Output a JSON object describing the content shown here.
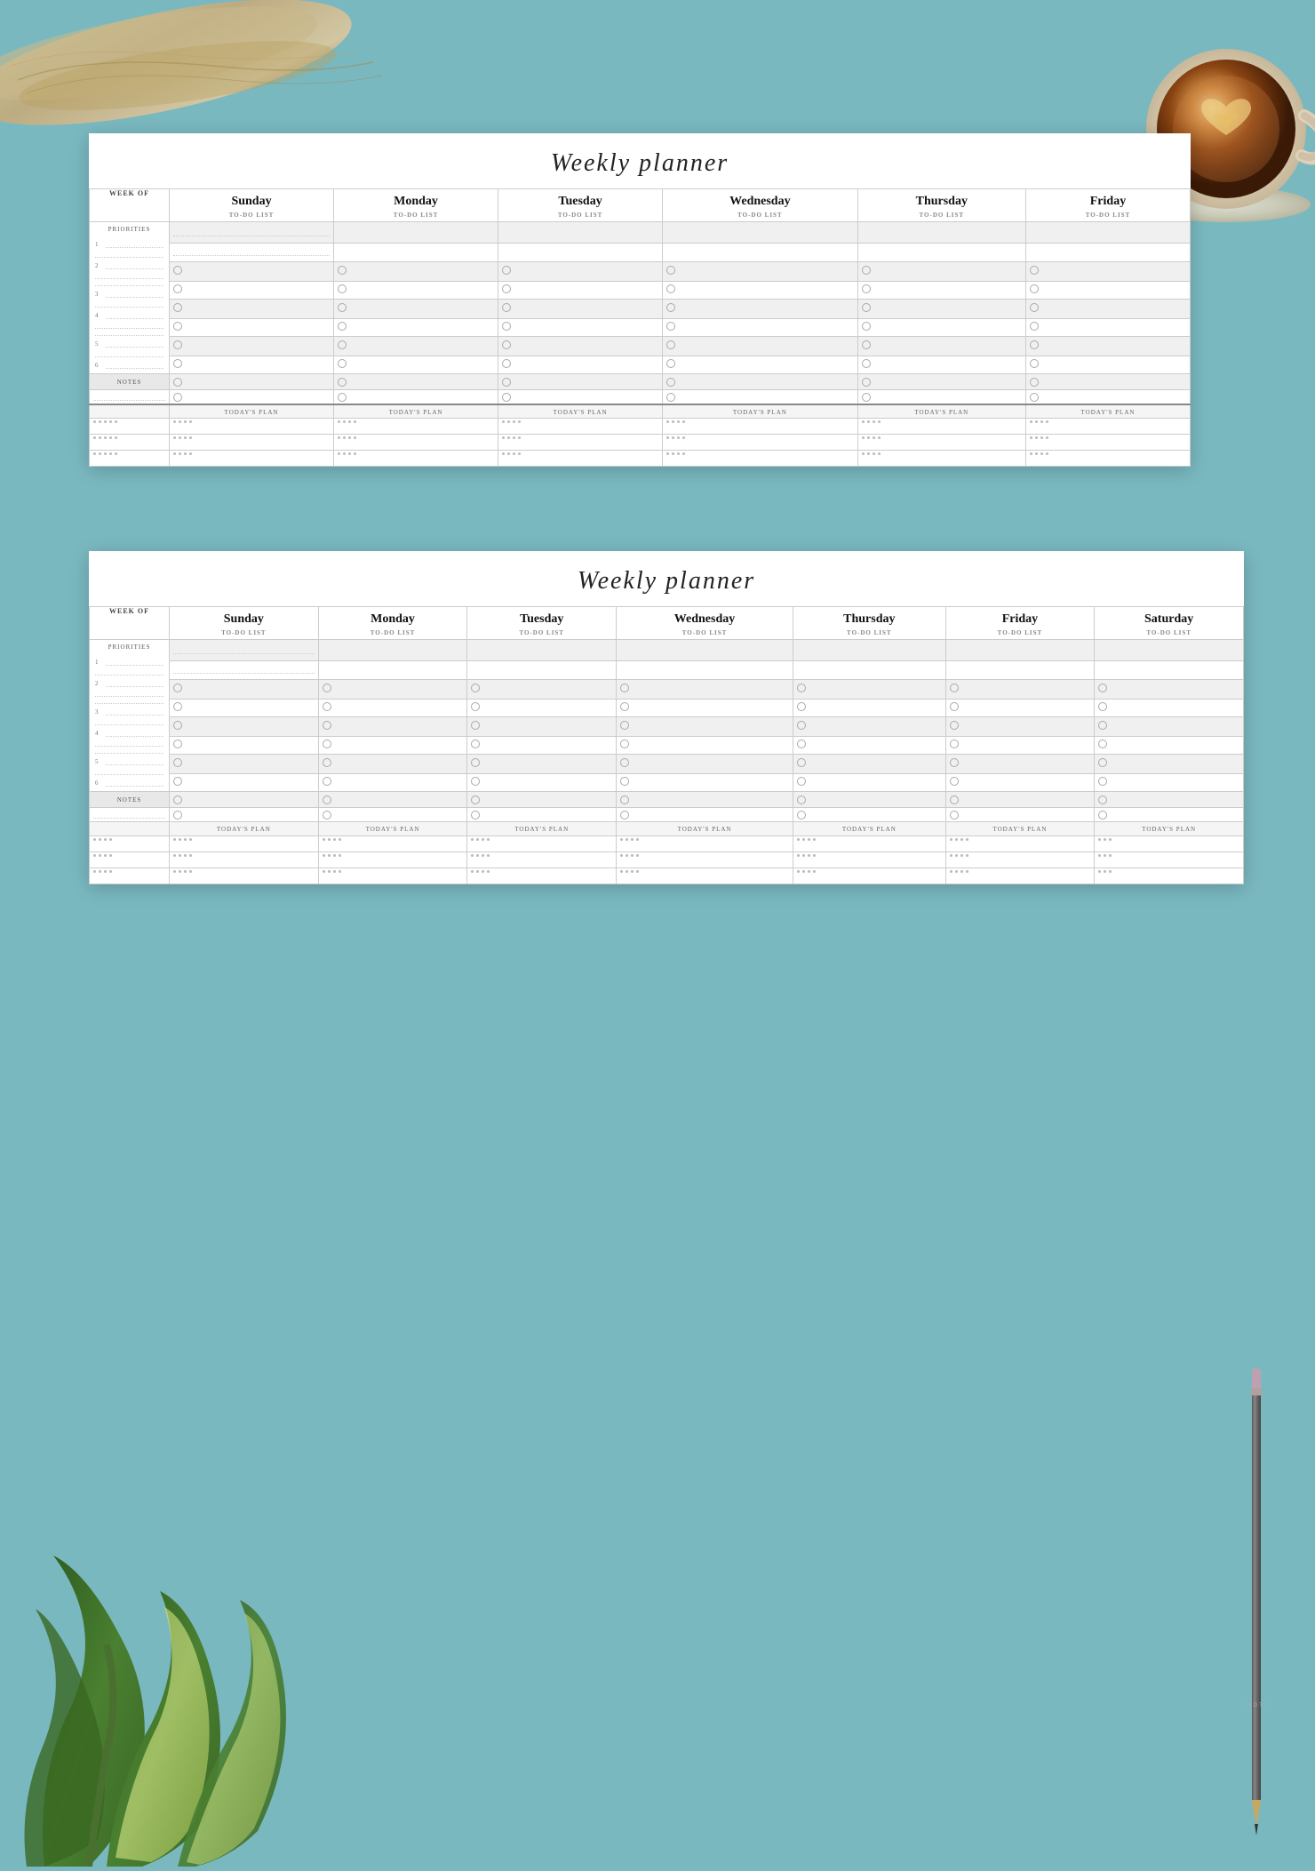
{
  "background": {
    "color": "#7ab8c0"
  },
  "page1": {
    "title": "Weekly planner",
    "week_of_label": "WEEK OF",
    "days": [
      "Sunday",
      "Monday",
      "Tuesday",
      "Wednesday",
      "Thursday",
      "Friday"
    ],
    "todo_label": "TO-DO LIST",
    "priorities_label": "PRIORITIES",
    "notes_label": "NOTES",
    "todays_plan_label": "TODAY'S PLAN",
    "priority_numbers": [
      "1",
      "2",
      "3",
      "4",
      "5",
      "6"
    ]
  },
  "page2": {
    "title": "Weekly planner",
    "week_of_label": "WEEK OF",
    "days": [
      "Sunday",
      "Monday",
      "Tuesday",
      "Wednesday",
      "Thursday",
      "Friday",
      "Saturday"
    ],
    "todo_label": "TO-DO LIST",
    "priorities_label": "PRIORITIES",
    "notes_label": "NOTES",
    "todays_plan_label": "TODAY'S PLAN",
    "priority_numbers": [
      "1",
      "2",
      "3",
      "4",
      "5",
      "6"
    ]
  }
}
